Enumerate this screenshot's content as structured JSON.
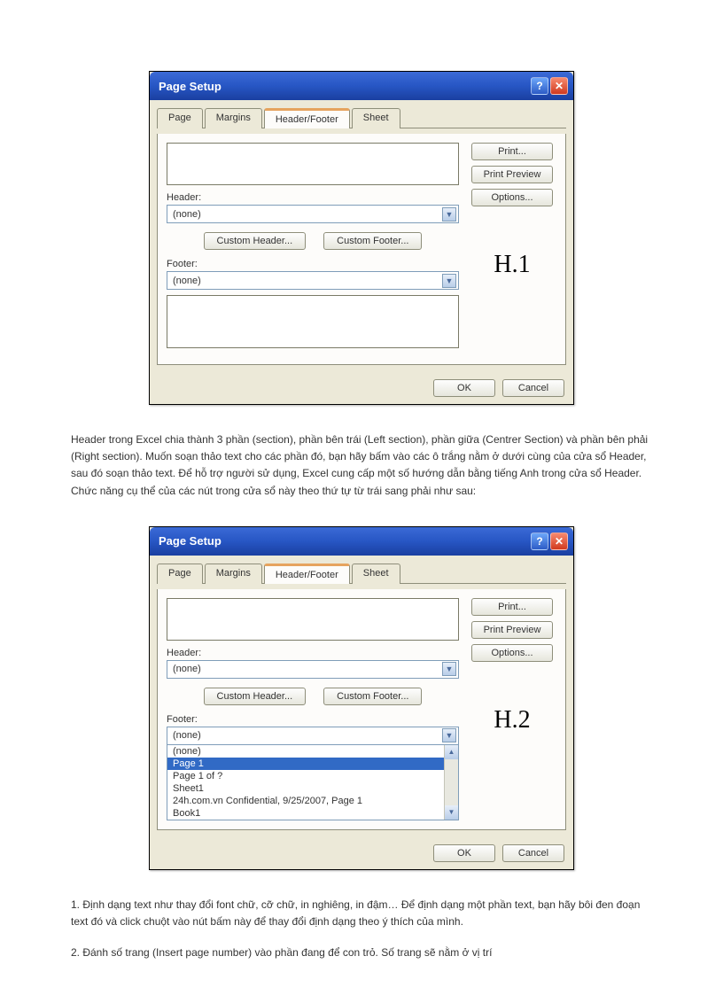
{
  "dialog": {
    "title": "Page Setup",
    "tabs": [
      "Page",
      "Margins",
      "Header/Footer",
      "Sheet"
    ],
    "active_tab": "Header/Footer",
    "header_label": "Header:",
    "footer_label": "Footer:",
    "header_value": "(none)",
    "footer_value": "(none)",
    "custom_header_btn": "Custom Header...",
    "custom_footer_btn": "Custom Footer...",
    "side_buttons": {
      "print": "Print...",
      "print_preview": "Print Preview",
      "options": "Options..."
    },
    "ok": "OK",
    "cancel": "Cancel",
    "fig1": "H.1",
    "fig2": "H.2",
    "footer_options": [
      "(none)",
      "Page 1",
      "Page 1 of ?",
      "Sheet1",
      "24h.com.vn Confidential, 9/25/2007, Page 1",
      "Book1"
    ],
    "footer_selected_index": 1
  },
  "text": {
    "p1": "Header trong Excel chia thành 3 phần (section), phần bên trái (Left section), phần giữa (Centrer Section) và phần bên phải (Right section). Muốn soạn thảo text cho các phần đó, bạn hãy bấm vào các ô trắng nằm ở dưới cùng của cửa sổ Header, sau đó soạn thảo text. Để hỗ trợ người sử dụng, Excel cung cấp một số hướng dẫn bằng tiếng Anh trong cửa sổ Header. Chức năng cụ thể của các nút trong cửa sổ này theo thứ tự từ trái sang phải như sau:",
    "p2": "1. Định dạng text như thay đổi font chữ, cỡ chữ, in nghiêng, in đậm… Để định dạng một phần text, bạn hãy bôi đen đoạn text đó và click chuột vào nút bấm này để thay đổi định dạng theo ý thích của mình.",
    "p3": "2. Đánh số trang (Insert page number) vào phần đang để con trỏ. Số trang sẽ nằm ở vị trí"
  }
}
